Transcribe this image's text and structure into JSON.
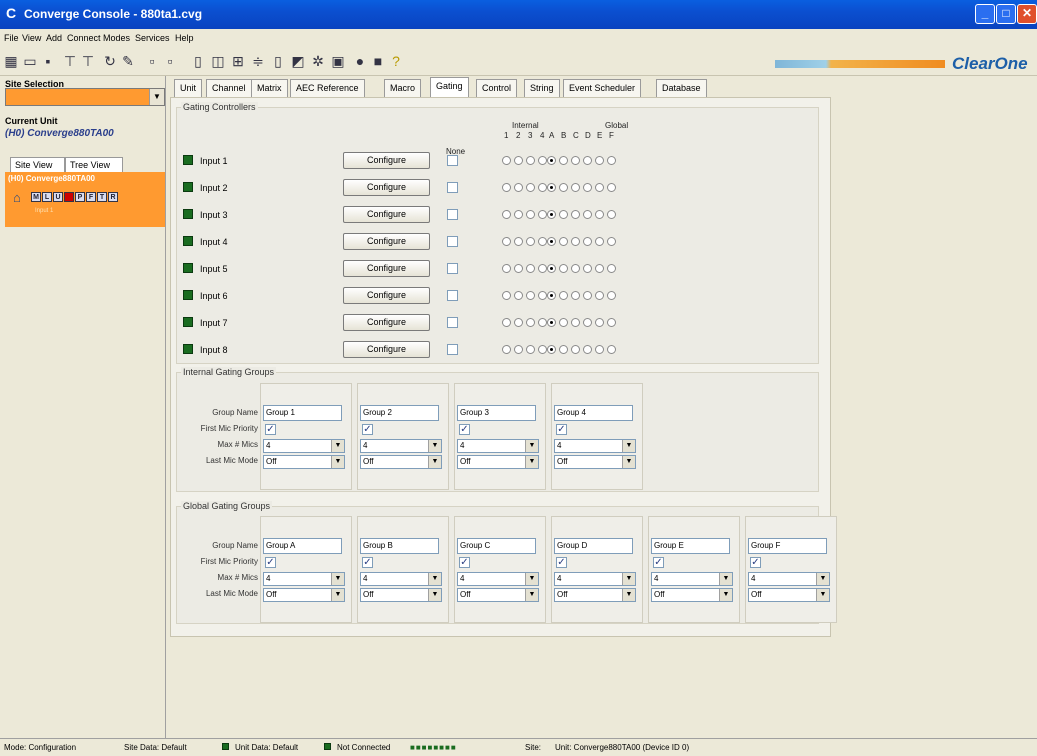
{
  "window": {
    "title": "Converge Console - 880ta1.cvg",
    "min": "_",
    "max": "□",
    "close": "✕"
  },
  "menu": [
    "File",
    "View",
    "Add",
    "Connect",
    "Modes",
    "Services",
    "Help"
  ],
  "brand": "ClearOne",
  "sidebar": {
    "site_selection_label": "Site Selection",
    "current_unit_label": "Current Unit",
    "current_unit_value": "(H0) Converge880TA00",
    "view_tabs": [
      "Site View",
      "Tree View"
    ],
    "unit_panel_name": "(H0) Converge880TA00",
    "unit_panel_sub": "Input 1",
    "unit_letters": [
      "M",
      "L",
      "U",
      "",
      "P",
      "F",
      "T",
      "R"
    ]
  },
  "tabs": [
    "Unit",
    "Channel",
    "Matrix",
    "AEC Reference",
    "Macro",
    "Gating",
    "Control",
    "String",
    "Event Scheduler",
    "Database"
  ],
  "active_tab": "Gating",
  "gating_controllers": {
    "label": "Gating Controllers",
    "none_label": "None",
    "internal_label": "Internal",
    "global_label": "Global",
    "internal_cols": [
      "1",
      "2",
      "3",
      "4"
    ],
    "global_cols": [
      "A",
      "B",
      "C",
      "D",
      "E",
      "F"
    ],
    "button_label": "Configure",
    "rows": [
      {
        "label": "Input 1",
        "selected": "A"
      },
      {
        "label": "Input 2",
        "selected": "A"
      },
      {
        "label": "Input 3",
        "selected": "A"
      },
      {
        "label": "Input 4",
        "selected": "A"
      },
      {
        "label": "Input 5",
        "selected": "A"
      },
      {
        "label": "Input 6",
        "selected": "A"
      },
      {
        "label": "Input 7",
        "selected": "A"
      },
      {
        "label": "Input 8",
        "selected": "A"
      }
    ]
  },
  "field_labels": {
    "group_name": "Group Name",
    "first_mic": "First Mic Priority",
    "max_mics": "Max # Mics",
    "last_mic": "Last Mic Mode"
  },
  "internal_groups": {
    "label": "Internal Gating Groups",
    "groups": [
      {
        "name": "Group 1",
        "first_mic": true,
        "max_mics": "4",
        "last_mic": "Off"
      },
      {
        "name": "Group 2",
        "first_mic": true,
        "max_mics": "4",
        "last_mic": "Off"
      },
      {
        "name": "Group 3",
        "first_mic": true,
        "max_mics": "4",
        "last_mic": "Off"
      },
      {
        "name": "Group 4",
        "first_mic": true,
        "max_mics": "4",
        "last_mic": "Off"
      }
    ]
  },
  "global_groups": {
    "label": "Global Gating Groups",
    "groups": [
      {
        "name": "Group A",
        "first_mic": true,
        "max_mics": "4",
        "last_mic": "Off"
      },
      {
        "name": "Group B",
        "first_mic": true,
        "max_mics": "4",
        "last_mic": "Off"
      },
      {
        "name": "Group C",
        "first_mic": true,
        "max_mics": "4",
        "last_mic": "Off"
      },
      {
        "name": "Group D",
        "first_mic": true,
        "max_mics": "4",
        "last_mic": "Off"
      },
      {
        "name": "Group E",
        "first_mic": true,
        "max_mics": "4",
        "last_mic": "Off"
      },
      {
        "name": "Group F",
        "first_mic": true,
        "max_mics": "4",
        "last_mic": "Off"
      }
    ]
  },
  "status": {
    "mode": "Mode: Configuration",
    "site_data": "Site Data: Default",
    "unit_data": "Unit Data: Default",
    "connection": "Not Connected",
    "site": "Site:",
    "unit": "Unit: Converge880TA00 (Device ID 0)"
  }
}
